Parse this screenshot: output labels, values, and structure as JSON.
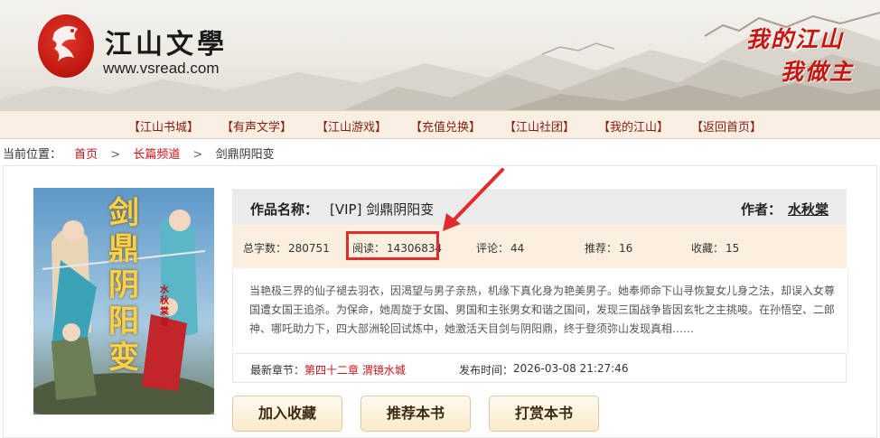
{
  "header": {
    "logo_title": "江山文學",
    "logo_url": "www.vsread.com",
    "slogan_line1": "我的江山",
    "slogan_line2": "我做主",
    "brand_color": "#c41a12"
  },
  "nav": {
    "items": [
      {
        "label": "【江山书城】"
      },
      {
        "label": "【有声文学】"
      },
      {
        "label": "【江山游戏】"
      },
      {
        "label": "【充值兑换】"
      },
      {
        "label": "【江山社团】"
      },
      {
        "label": "【我的江山】"
      },
      {
        "label": "【返回首页】"
      }
    ]
  },
  "breadcrumb": {
    "prefix": "当前位置：",
    "home": "首页",
    "channel": "长篇频道",
    "current": "剑鼎阴阳变",
    "separator": ">"
  },
  "book": {
    "title_label": "作品名称：",
    "title": "[VIP] 剑鼎阴阳变",
    "author_label": "作者：",
    "author": "水秋棠",
    "cover_text": "剑鼎阴阳变",
    "cover_signature": "水秋棠著",
    "stats": {
      "words_label": "总字数：",
      "words": "280751",
      "reads_label": "阅读：",
      "reads": "14306834",
      "comments_label": "评论：",
      "comments": "44",
      "recommends_label": "推荐：",
      "recommends": "16",
      "favorites_label": "收藏：",
      "favorites": "15"
    },
    "summary": "当艳极三界的仙子褪去羽衣，因渴望与男子亲热，机缘下真化身为艳美男子。她奉师命下山寻恢复女儿身之法，却误入女尊国遭女国王追杀。为保命，她周旋于女国、男国和主张男女和谐之国间，发现三国战争皆因玄牝之主挑唆。在孙悟空、二郎神、哪吒助力下，四大部洲轮回试炼中，她激活天目剑与阴阳鼎，终于登须弥山发现真相……",
    "latest_label": "最新章节：",
    "latest_chapter": "第四十二章 渭镜水城",
    "publish_label": "发布时间：",
    "publish_time": "2026-03-08 21:27:46"
  },
  "actions": {
    "favorite": "加入收藏",
    "recommend": "推荐本书",
    "tip": "打赏本书"
  },
  "colors": {
    "link_red": "#c8141a",
    "highlight": "#e22b2b",
    "stats_bg": "#fbefe0",
    "title_bg": "#ebebeb"
  }
}
